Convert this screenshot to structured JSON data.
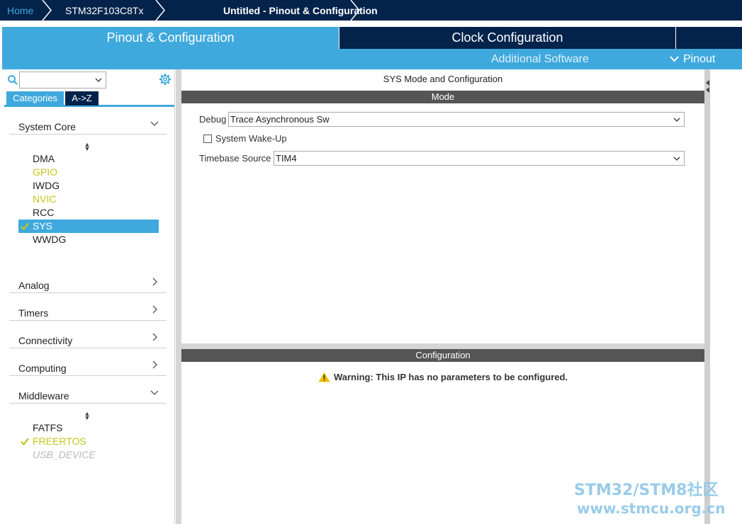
{
  "breadcrumb": {
    "home": "Home",
    "device": "STM32F103C8Tx",
    "project": "Untitled - Pinout & Configuration"
  },
  "tabs": {
    "pinout_config": "Pinout & Configuration",
    "clock_config": "Clock Configuration",
    "additional_software": "Additional Software",
    "pinout": "Pinout"
  },
  "sidebar": {
    "search_value": "",
    "categories_tab": "Categories",
    "az_tab": "A->Z",
    "system_core": {
      "label": "System Core",
      "items": [
        {
          "label": "DMA",
          "state": "normal"
        },
        {
          "label": "GPIO",
          "state": "configured"
        },
        {
          "label": "IWDG",
          "state": "normal"
        },
        {
          "label": "NVIC",
          "state": "configured"
        },
        {
          "label": "RCC",
          "state": "normal"
        },
        {
          "label": "SYS",
          "state": "selected"
        },
        {
          "label": "WWDG",
          "state": "normal"
        }
      ]
    },
    "analog": "Analog",
    "timers": "Timers",
    "connectivity": "Connectivity",
    "computing": "Computing",
    "middleware": {
      "label": "Middleware",
      "items": [
        {
          "label": "FATFS",
          "state": "normal"
        },
        {
          "label": "FREERTOS",
          "state": "configured"
        },
        {
          "label": "USB_DEVICE",
          "state": "disabled"
        }
      ]
    }
  },
  "main": {
    "panel_title": "SYS Mode and Configuration",
    "mode_header": "Mode",
    "debug_label": "Debug",
    "debug_value": "Trace Asynchronous Sw",
    "wakeup_label": "System Wake-Up",
    "wakeup_checked": false,
    "timebase_label": "Timebase Source",
    "timebase_value": "TIM4",
    "config_header": "Configuration",
    "warning": "Warning: This IP has no parameters to be configured."
  },
  "watermark": {
    "line1": "STM32/STM8社区",
    "line2": "www.stmcu.org.cn"
  },
  "colors": {
    "navy": "#03234b",
    "accent": "#3fa9dd",
    "configured": "#c2c71b",
    "header_gray": "#555555",
    "warning": "#f2c200"
  }
}
